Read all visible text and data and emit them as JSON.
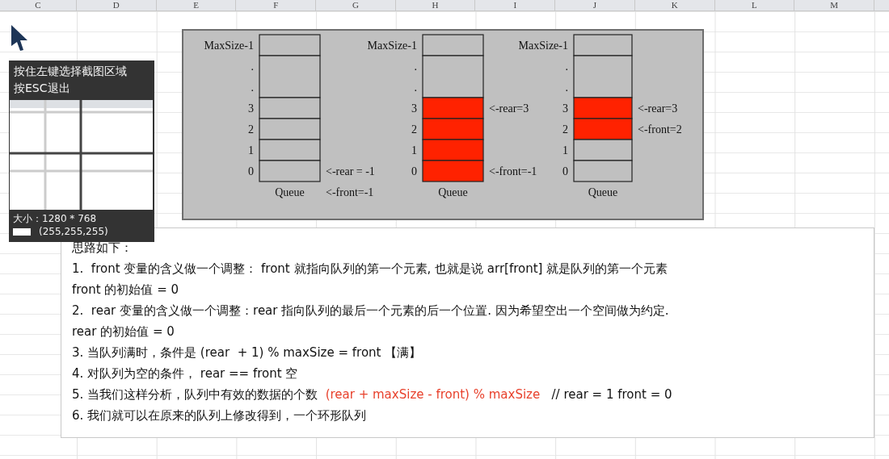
{
  "sheet": {
    "columns": [
      "C",
      "D",
      "E",
      "F",
      "G",
      "H",
      "I",
      "J",
      "K",
      "L",
      "M"
    ]
  },
  "diagram": {
    "queues": [
      {
        "caption": "Queue",
        "caption_note": "<-front=-1",
        "rows": [
          {
            "kind": "cell",
            "label": "MaxSize-1",
            "filled": false
          },
          {
            "kind": "gap",
            "labels": [
              ".",
              "."
            ],
            "filled": false
          },
          {
            "kind": "cell",
            "label": "3",
            "filled": false
          },
          {
            "kind": "cell",
            "label": "2",
            "filled": false
          },
          {
            "kind": "cell",
            "label": "1",
            "filled": false
          },
          {
            "kind": "cell",
            "label": "0",
            "filled": false,
            "note": "<-rear = -1"
          }
        ]
      },
      {
        "caption": "Queue",
        "rows": [
          {
            "kind": "cell",
            "label": "MaxSize-1",
            "filled": false
          },
          {
            "kind": "gap",
            "labels": [
              ".",
              "."
            ],
            "filled": false
          },
          {
            "kind": "cell",
            "label": "3",
            "filled": true,
            "note": "<-rear=3"
          },
          {
            "kind": "cell",
            "label": "2",
            "filled": true
          },
          {
            "kind": "cell",
            "label": "1",
            "filled": true
          },
          {
            "kind": "cell",
            "label": "0",
            "filled": true,
            "note": "<-front=-1"
          }
        ]
      },
      {
        "caption": "Queue",
        "rows": [
          {
            "kind": "cell",
            "label": "MaxSize-1",
            "filled": false
          },
          {
            "kind": "gap",
            "labels": [
              ".",
              "."
            ],
            "filled": false
          },
          {
            "kind": "cell",
            "label": "3",
            "filled": true,
            "note": "<-rear=3"
          },
          {
            "kind": "cell",
            "label": "2",
            "filled": true,
            "note": "<-front=2"
          },
          {
            "kind": "cell",
            "label": "1",
            "filled": false
          },
          {
            "kind": "cell",
            "label": "0",
            "filled": false
          }
        ]
      }
    ]
  },
  "notes": {
    "heading": "思路如下：",
    "lines": [
      {
        "parts": [
          {
            "kind": "plain",
            "text": "1.  front 变量的含义做一个调整： front 就指向队列的第一个元素, 也就是说 arr[front] 就是队列的第一个元素"
          }
        ]
      },
      {
        "parts": [
          {
            "kind": "plain",
            "text": "front 的初始值 = 0"
          }
        ]
      },
      {
        "parts": [
          {
            "kind": "plain",
            "text": "2.  rear 变量的含义做一个调整：rear 指向队列的最后一个元素的后一个位置. 因为希望空出一个空间做为约定."
          }
        ]
      },
      {
        "parts": [
          {
            "kind": "plain",
            "text": "rear 的初始值 = 0"
          }
        ]
      },
      {
        "parts": [
          {
            "kind": "plain",
            "text": "3. 当队列满时，条件是 (rear  + 1) % maxSize = front 【满】"
          }
        ]
      },
      {
        "parts": [
          {
            "kind": "plain",
            "text": "4. 对队列为空的条件， rear == front 空"
          }
        ]
      },
      {
        "parts": [
          {
            "kind": "plain",
            "text": "5. 当我们这样分析，队列中有效的数据的个数  "
          },
          {
            "kind": "formula",
            "text": "(rear + maxSize - front) % maxSize"
          },
          {
            "kind": "plain",
            "text": "   // rear = 1 front = 0"
          }
        ]
      },
      {
        "parts": [
          {
            "kind": "plain",
            "text": "6. 我们就可以在原来的队列上修改得到，一个环形队列"
          }
        ]
      }
    ]
  },
  "capture_tool": {
    "hint_lines": [
      "按住左键选择截图区域",
      "按ESC退出"
    ],
    "size": "大小：1280 * 768",
    "rgb_readout": "(255,255,255)"
  }
}
